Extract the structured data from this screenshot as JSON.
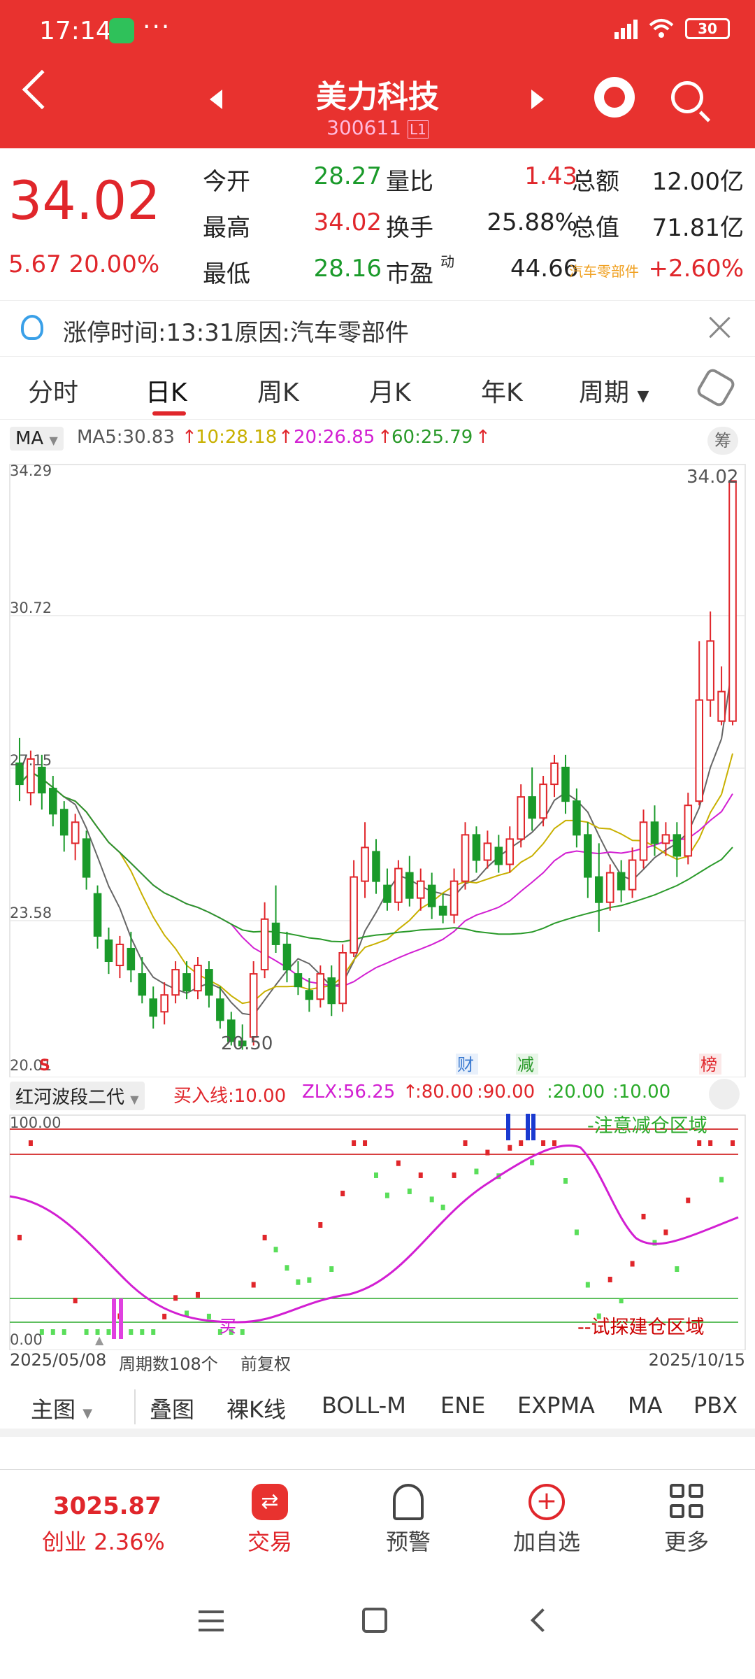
{
  "status": {
    "time": "17:14",
    "dots": "···",
    "battery": "30"
  },
  "header": {
    "title": "美力科技",
    "code": "300611",
    "code_tag": "L1"
  },
  "quote": {
    "price": "34.02",
    "change": "5.67  20.00%",
    "rows": [
      {
        "l1": "今开",
        "v1": "28.27",
        "l2": "量比",
        "v2": "1.43",
        "l3": "总额",
        "v3": "12.00亿"
      },
      {
        "l1": "最高",
        "v1": "34.02",
        "l2": "换手",
        "v2": "25.88%",
        "l3": "总值",
        "v3": "71.81亿"
      },
      {
        "l1": "最低",
        "v1": "28.16",
        "l2": "市盈",
        "l2sup": "动",
        "v2": "44.66",
        "l3": "汽车零部件",
        "v3": "+2.60%"
      }
    ]
  },
  "limit_info": {
    "text": "涨停时间:13:31原因:汽车零部件"
  },
  "tabs": [
    "分时",
    "日K",
    "周K",
    "月K",
    "年K",
    "周期"
  ],
  "ma_bar": {
    "selector": "MA",
    "ma5": "MA5:30.83",
    "ma10": "10:28.18",
    "ma20": "20:26.85",
    "ma60": "60:25.79",
    "calc": "筹"
  },
  "main_chart": {
    "y_labels": [
      "34.29",
      "30.72",
      "27.15",
      "23.58",
      "20.01"
    ],
    "high_label": "34.02",
    "low_label": "20.50",
    "markers": [
      "财",
      "减",
      "榜"
    ],
    "s_marker": "S"
  },
  "indicator": {
    "name": "红河波段二代",
    "buy": "买入线:10.00",
    "zlx": "ZLX:56.25",
    "l80": ":80.00",
    "l90": ":90.00",
    "l20": ":20.00",
    "l10": ":10.00",
    "top_label": "100.00",
    "bottom_label": "0.00",
    "warn_zone": "-注意减仓区域",
    "build_zone": "--试探建仓区域",
    "buy_mark": "买"
  },
  "xaxis": {
    "start": "2025/05/08",
    "periods": "周期数108个",
    "adjust": "前复权",
    "end": "2025/10/15"
  },
  "bottom_tabs": [
    "主图",
    "叠图",
    "裸K线",
    "BOLL-M",
    "ENE",
    "EXPMA",
    "MA",
    "PBX"
  ],
  "nav": {
    "index_value": "3025.87",
    "index_name": "创业 2.36%",
    "items": [
      "交易",
      "预警",
      "加自选",
      "更多"
    ]
  },
  "chart_data": {
    "type": "candlestick",
    "title": "",
    "y_range": [
      20.01,
      34.29
    ],
    "candles": [
      {
        "o": 27.3,
        "c": 26.8,
        "h": 27.9,
        "l": 26.4
      },
      {
        "o": 26.6,
        "c": 27.4,
        "h": 27.6,
        "l": 26.3
      },
      {
        "o": 27.2,
        "c": 26.6,
        "h": 27.5,
        "l": 26.2
      },
      {
        "o": 26.7,
        "c": 26.1,
        "h": 27.0,
        "l": 25.8
      },
      {
        "o": 26.2,
        "c": 25.6,
        "h": 26.4,
        "l": 25.2
      },
      {
        "o": 25.4,
        "c": 25.9,
        "h": 26.1,
        "l": 25.0
      },
      {
        "o": 25.5,
        "c": 24.6,
        "h": 25.7,
        "l": 24.3
      },
      {
        "o": 24.2,
        "c": 23.2,
        "h": 24.4,
        "l": 22.9
      },
      {
        "o": 23.1,
        "c": 22.6,
        "h": 23.4,
        "l": 22.3
      },
      {
        "o": 22.5,
        "c": 23.0,
        "h": 23.2,
        "l": 22.2
      },
      {
        "o": 22.9,
        "c": 22.4,
        "h": 23.3,
        "l": 22.1
      },
      {
        "o": 22.3,
        "c": 21.8,
        "h": 22.7,
        "l": 21.6
      },
      {
        "o": 21.7,
        "c": 21.3,
        "h": 22.0,
        "l": 21.0
      },
      {
        "o": 21.4,
        "c": 21.8,
        "h": 22.1,
        "l": 21.1
      },
      {
        "o": 21.8,
        "c": 22.4,
        "h": 22.6,
        "l": 21.6
      },
      {
        "o": 22.3,
        "c": 21.9,
        "h": 22.6,
        "l": 21.7
      },
      {
        "o": 21.9,
        "c": 22.5,
        "h": 22.7,
        "l": 21.7
      },
      {
        "o": 22.4,
        "c": 21.8,
        "h": 22.6,
        "l": 21.5
      },
      {
        "o": 21.7,
        "c": 21.2,
        "h": 22.0,
        "l": 21.0
      },
      {
        "o": 21.2,
        "c": 20.7,
        "h": 21.4,
        "l": 20.6
      },
      {
        "o": 20.7,
        "c": 20.6,
        "h": 21.1,
        "l": 20.5
      },
      {
        "o": 20.8,
        "c": 22.3,
        "h": 22.6,
        "l": 20.6
      },
      {
        "o": 22.4,
        "c": 23.6,
        "h": 24.0,
        "l": 22.2
      },
      {
        "o": 23.5,
        "c": 23.0,
        "h": 24.4,
        "l": 22.8
      },
      {
        "o": 23.0,
        "c": 22.4,
        "h": 23.3,
        "l": 22.1
      },
      {
        "o": 22.3,
        "c": 22.0,
        "h": 22.6,
        "l": 21.8
      },
      {
        "o": 21.9,
        "c": 21.7,
        "h": 22.2,
        "l": 21.4
      },
      {
        "o": 21.7,
        "c": 22.3,
        "h": 22.5,
        "l": 21.5
      },
      {
        "o": 22.2,
        "c": 21.6,
        "h": 22.5,
        "l": 21.3
      },
      {
        "o": 21.6,
        "c": 22.8,
        "h": 23.0,
        "l": 21.4
      },
      {
        "o": 22.8,
        "c": 24.6,
        "h": 25.0,
        "l": 22.7
      },
      {
        "o": 24.5,
        "c": 25.3,
        "h": 25.9,
        "l": 24.1
      },
      {
        "o": 25.2,
        "c": 24.5,
        "h": 25.5,
        "l": 24.2
      },
      {
        "o": 24.4,
        "c": 24.0,
        "h": 24.8,
        "l": 23.8
      },
      {
        "o": 24.0,
        "c": 24.8,
        "h": 25.0,
        "l": 23.8
      },
      {
        "o": 24.7,
        "c": 24.1,
        "h": 25.1,
        "l": 23.9
      },
      {
        "o": 24.1,
        "c": 24.5,
        "h": 24.8,
        "l": 23.8
      },
      {
        "o": 24.4,
        "c": 23.9,
        "h": 24.7,
        "l": 23.6
      },
      {
        "o": 23.9,
        "c": 23.7,
        "h": 24.2,
        "l": 23.5
      },
      {
        "o": 23.7,
        "c": 24.5,
        "h": 24.8,
        "l": 23.5
      },
      {
        "o": 24.5,
        "c": 25.6,
        "h": 25.9,
        "l": 24.3
      },
      {
        "o": 25.6,
        "c": 25.0,
        "h": 25.8,
        "l": 24.7
      },
      {
        "o": 25.0,
        "c": 25.4,
        "h": 25.7,
        "l": 24.8
      },
      {
        "o": 25.3,
        "c": 24.9,
        "h": 25.6,
        "l": 24.7
      },
      {
        "o": 24.9,
        "c": 25.5,
        "h": 25.8,
        "l": 24.7
      },
      {
        "o": 25.5,
        "c": 26.5,
        "h": 26.8,
        "l": 25.3
      },
      {
        "o": 26.5,
        "c": 26.0,
        "h": 27.2,
        "l": 25.7
      },
      {
        "o": 26.0,
        "c": 26.8,
        "h": 27.0,
        "l": 25.8
      },
      {
        "o": 26.8,
        "c": 27.3,
        "h": 27.5,
        "l": 26.5
      },
      {
        "o": 27.2,
        "c": 26.4,
        "h": 27.5,
        "l": 26.1
      },
      {
        "o": 26.4,
        "c": 25.6,
        "h": 26.7,
        "l": 25.3
      },
      {
        "o": 25.6,
        "c": 24.6,
        "h": 25.9,
        "l": 24.1
      },
      {
        "o": 24.6,
        "c": 24.0,
        "h": 25.4,
        "l": 23.3
      },
      {
        "o": 24.0,
        "c": 24.7,
        "h": 24.9,
        "l": 23.8
      },
      {
        "o": 24.7,
        "c": 24.3,
        "h": 25.0,
        "l": 24.0
      },
      {
        "o": 24.3,
        "c": 25.0,
        "h": 25.3,
        "l": 24.1
      },
      {
        "o": 25.0,
        "c": 25.9,
        "h": 26.2,
        "l": 24.8
      },
      {
        "o": 25.9,
        "c": 25.4,
        "h": 26.3,
        "l": 25.1
      },
      {
        "o": 25.4,
        "c": 25.6,
        "h": 25.9,
        "l": 25.1
      },
      {
        "o": 25.6,
        "c": 25.1,
        "h": 25.9,
        "l": 24.6
      },
      {
        "o": 25.1,
        "c": 26.3,
        "h": 26.6,
        "l": 24.9
      },
      {
        "o": 26.4,
        "c": 28.8,
        "h": 30.2,
        "l": 26.3
      },
      {
        "o": 28.8,
        "c": 30.2,
        "h": 30.9,
        "l": 28.4
      },
      {
        "o": 28.3,
        "c": 29.0,
        "h": 29.6,
        "l": 28.2
      },
      {
        "o": 28.3,
        "c": 34.0,
        "h": 34.0,
        "l": 28.2
      }
    ]
  }
}
